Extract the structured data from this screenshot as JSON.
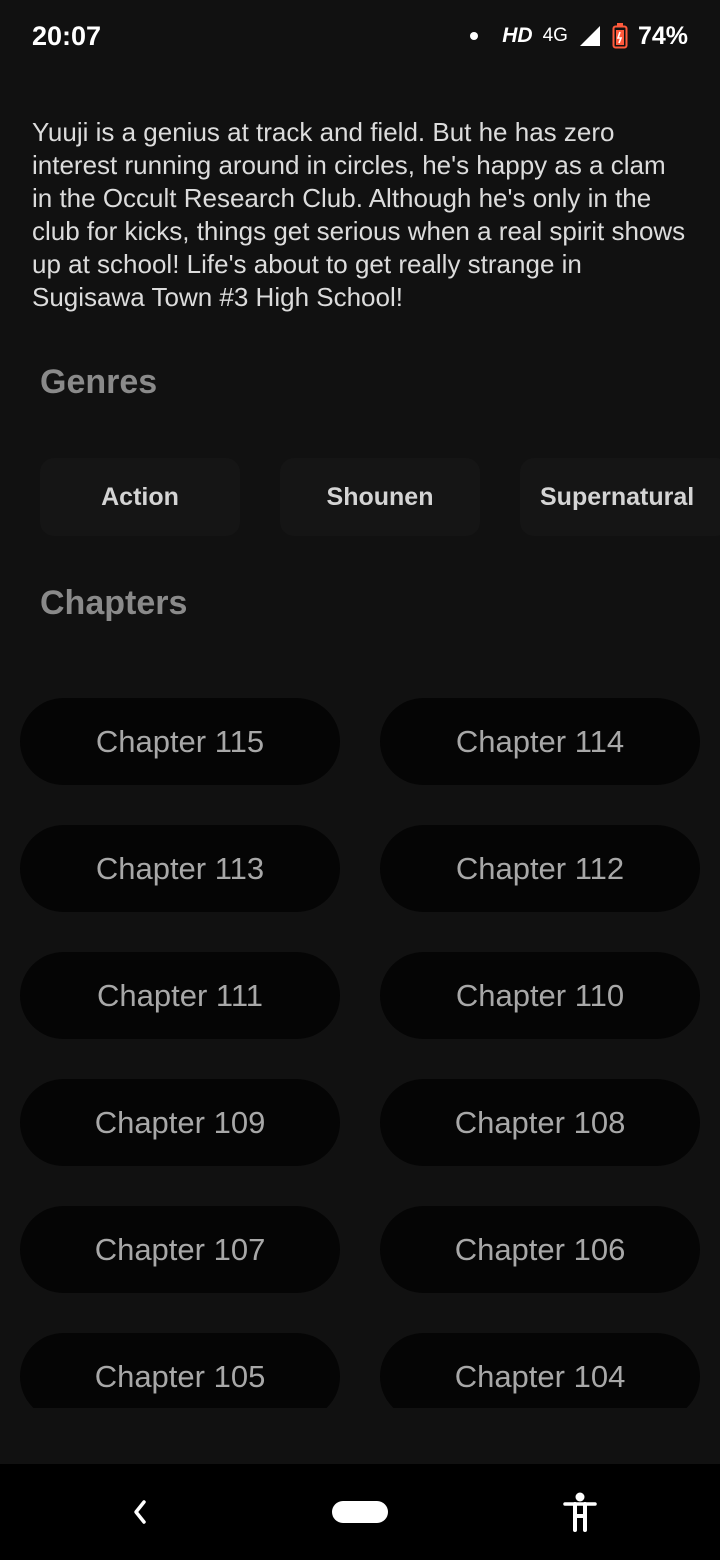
{
  "status_bar": {
    "time": "20:07",
    "hd": "HD",
    "network": "4G",
    "battery": "74%",
    "icons": [
      "notification-dot-icon",
      "signal-icon",
      "battery-icon"
    ]
  },
  "description": "Yuuji is a genius at track and field. But he has zero interest running around in circles, he's happy as a clam in the Occult Research Club. Although he's only in the club for kicks, things get serious when a real spirit shows up at school! Life's about to get really strange in Sugisawa Town #3 High School!",
  "genres": {
    "title": "Genres",
    "items": [
      "Action",
      "Shounen",
      "Supernatural"
    ]
  },
  "chapters": {
    "title": "Chapters",
    "items": [
      "Chapter 115",
      "Chapter 114",
      "Chapter 113",
      "Chapter 112",
      "Chapter 111",
      "Chapter 110",
      "Chapter 109",
      "Chapter 108",
      "Chapter 107",
      "Chapter 106",
      "Chapter 105",
      "Chapter 104"
    ]
  },
  "nav_bar": {
    "icons": [
      "back-icon",
      "home-pill-icon",
      "accessibility-icon"
    ]
  }
}
